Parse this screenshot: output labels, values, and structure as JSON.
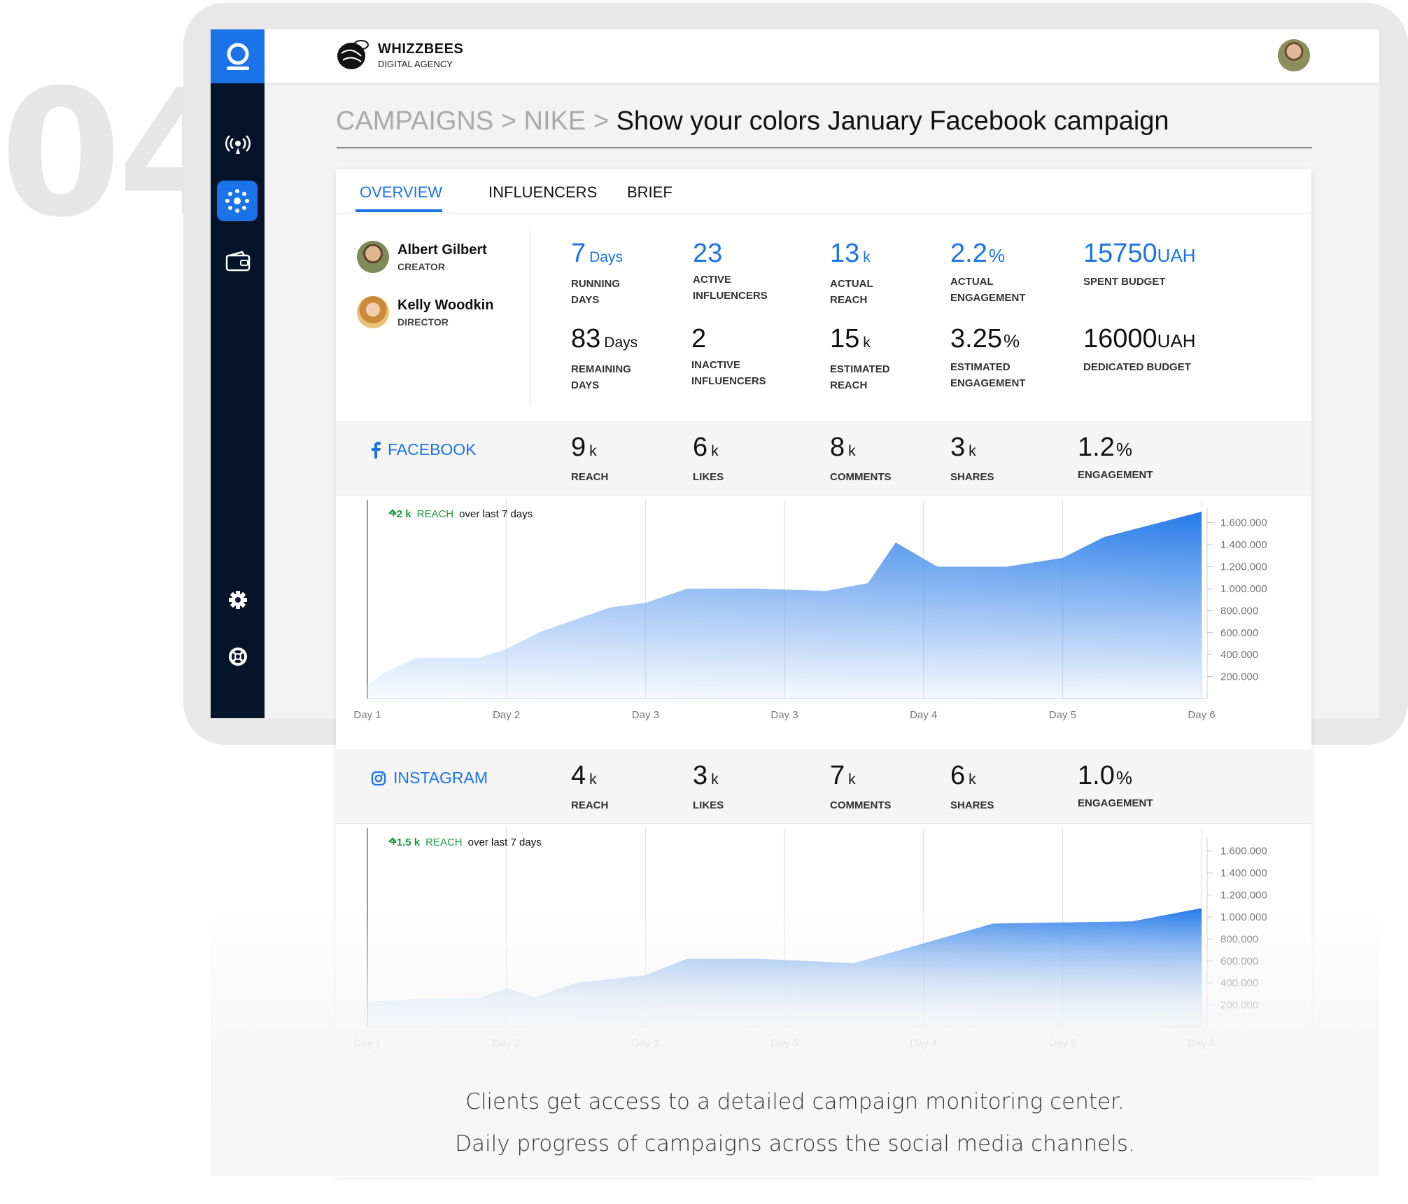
{
  "step_number": "04",
  "brand": {
    "name": "WHIZZBEES",
    "sub": "DIGITAL AGENCY"
  },
  "breadcrumb": {
    "part1": "CAMPAIGNS",
    "sep1": ">",
    "part2": "NIKE",
    "sep2": ">",
    "title": "Show your colors January Facebook campaign"
  },
  "tabs": [
    "OVERVIEW",
    "INFLUENCERS",
    "BRIEF"
  ],
  "people": [
    {
      "name": "Albert Gilbert",
      "role": "CREATOR"
    },
    {
      "name": "Kelly Woodkin",
      "role": "DIRECTOR"
    }
  ],
  "stats_top": [
    {
      "value": "7",
      "unit": "Days",
      "label1": "RUNNING",
      "label2": "DAYS"
    },
    {
      "value": "23",
      "unit": "",
      "label1": "ACTIVE",
      "label2": "INFLUENCERS"
    },
    {
      "value": "13",
      "unit": "k",
      "label1": "ACTUAL",
      "label2": "REACH"
    },
    {
      "value": "2.2",
      "unit": "%",
      "label1": "ACTUAL",
      "label2": "ENGAGEMENT"
    },
    {
      "value": "15750",
      "unit": "UAH",
      "label1": "SPENT BUDGET",
      "label2": ""
    }
  ],
  "stats_bottom": [
    {
      "value": "83",
      "unit": "Days",
      "label1": "REMAINING",
      "label2": "DAYS"
    },
    {
      "value": "2",
      "unit": "",
      "label1": "INACTIVE",
      "label2": "INFLUENCERS"
    },
    {
      "value": "15",
      "unit": "k",
      "label1": "ESTIMATED",
      "label2": "REACH"
    },
    {
      "value": "3.25",
      "unit": "%",
      "label1": "ESTIMATED",
      "label2": "ENGAGEMENT"
    },
    {
      "value": "16000",
      "unit": "UAH",
      "label1": "DEDICATED BUDGET",
      "label2": ""
    }
  ],
  "facebook": {
    "name": "FACEBOOK",
    "stats": [
      {
        "value": "9",
        "unit": "k",
        "label": "REACH"
      },
      {
        "value": "6",
        "unit": "k",
        "label": "LIKES"
      },
      {
        "value": "8",
        "unit": "k",
        "label": "COMMENTS"
      },
      {
        "value": "3",
        "unit": "k",
        "label": "SHARES"
      },
      {
        "value": "1.2",
        "unit": "%",
        "label": "ENGAGEMENT"
      }
    ],
    "badge": {
      "delta": "+2 k",
      "metric": "REACH",
      "text": "over last 7 days"
    }
  },
  "instagram": {
    "name": "INSTAGRAM",
    "stats": [
      {
        "value": "4",
        "unit": "k",
        "label": "REACH"
      },
      {
        "value": "3",
        "unit": "k",
        "label": "LIKES"
      },
      {
        "value": "7",
        "unit": "k",
        "label": "COMMENTS"
      },
      {
        "value": "6",
        "unit": "k",
        "label": "SHARES"
      },
      {
        "value": "1.0",
        "unit": "%",
        "label": "ENGAGEMENT"
      }
    ],
    "badge": {
      "delta": "+1.5 k",
      "metric": "REACH",
      "text": "over last 7 days"
    }
  },
  "chart_data": [
    {
      "type": "area",
      "x": [
        "Day 1",
        "Day 2",
        "Day 3",
        "Day 3",
        "Day 4",
        "Day 5",
        "Day 6"
      ],
      "ytick_labels": [
        "1.600.000",
        "1.400.000",
        "1.200.000",
        "1.000.000",
        "800.000",
        "600.000",
        "400.000",
        "200.000"
      ],
      "ylim": [
        0,
        1700000
      ],
      "points": [
        [
          0,
          120000
        ],
        [
          0.1,
          220000
        ],
        [
          0.35,
          370000
        ],
        [
          0.8,
          370000
        ],
        [
          1,
          450000
        ],
        [
          1.25,
          610000
        ],
        [
          1.5,
          720000
        ],
        [
          1.75,
          830000
        ],
        [
          2,
          870000
        ],
        [
          2.3,
          1000000
        ],
        [
          2.8,
          1000000
        ],
        [
          3.3,
          980000
        ],
        [
          3.6,
          1050000
        ],
        [
          3.8,
          1420000
        ],
        [
          4.1,
          1200000
        ],
        [
          4.6,
          1200000
        ],
        [
          5,
          1280000
        ],
        [
          5.3,
          1470000
        ],
        [
          6,
          1700000
        ]
      ],
      "color": "#1a73e8"
    },
    {
      "type": "area",
      "x": [
        "Day 1",
        "Day 2",
        "Day 3",
        "Day 3",
        "Day 4",
        "Day 5",
        "Day 6"
      ],
      "ytick_labels": [
        "1.600.000",
        "1.400.000",
        "1.200.000",
        "1.000.000",
        "800.000",
        "600.000",
        "400.000",
        "200.000"
      ],
      "ylim": [
        0,
        1700000
      ],
      "points": [
        [
          0,
          230000
        ],
        [
          0.5,
          260000
        ],
        [
          0.8,
          260000
        ],
        [
          1,
          350000
        ],
        [
          1.2,
          270000
        ],
        [
          1.5,
          400000
        ],
        [
          2,
          470000
        ],
        [
          2.3,
          620000
        ],
        [
          2.8,
          620000
        ],
        [
          3.5,
          580000
        ],
        [
          4,
          760000
        ],
        [
          4.5,
          940000
        ],
        [
          5,
          950000
        ],
        [
          5.5,
          960000
        ],
        [
          6,
          1080000
        ]
      ],
      "color": "#1a73e8"
    }
  ],
  "caption": {
    "line1": "Clients get access to a detailed campaign monitoring center.",
    "line2": "Daily progress of campaigns across the social media channels."
  },
  "colors": {
    "accent": "#1a73e8",
    "sidebar": "#06142a",
    "positive": "#1a9a3f"
  }
}
